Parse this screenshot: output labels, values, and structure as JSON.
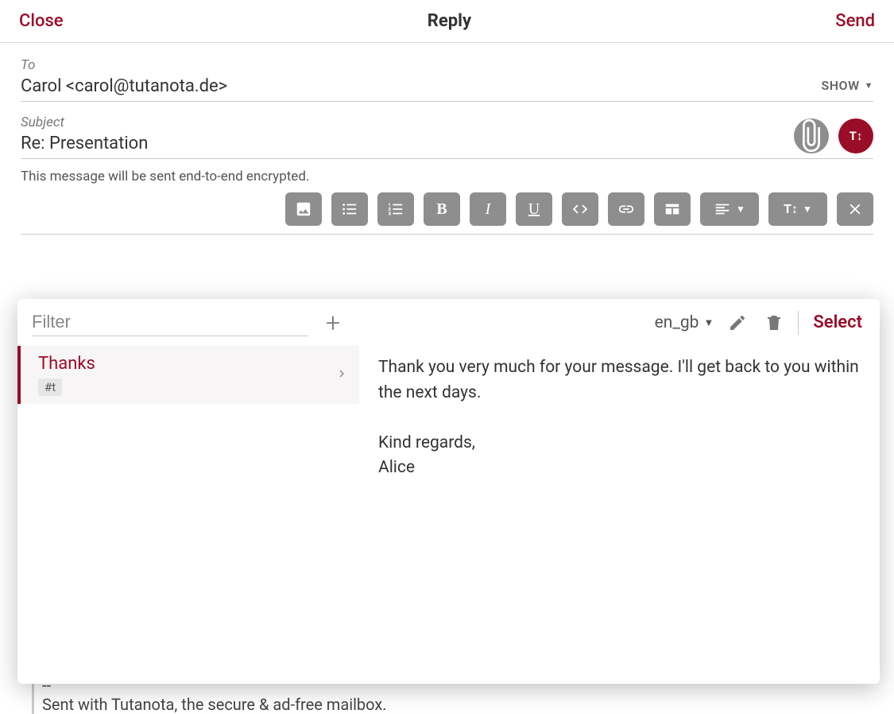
{
  "header": {
    "close": "Close",
    "title": "Reply",
    "send": "Send"
  },
  "to": {
    "label": "To",
    "value": "Carol <carol@tutanota.de>",
    "show": "SHOW"
  },
  "subject": {
    "label": "Subject",
    "value": "Re: Presentation"
  },
  "encrypt_note": "This message will be sent end-to-end encrypted.",
  "encrypt_badge": "T↕",
  "toolbar": {
    "size_label": "T↕"
  },
  "quote": {
    "sep": "--",
    "line": "Sent with Tutanota, the secure & ad-free mailbox."
  },
  "templates": {
    "filter_placeholder": "Filter",
    "lang": "en_gb",
    "select": "Select",
    "items": [
      {
        "title": "Thanks",
        "tag": "#t"
      }
    ],
    "preview": {
      "p1": "Thank you very much for your message. I'll get back to you within the next days.",
      "p2": "Kind regards,",
      "p3": "Alice"
    }
  }
}
